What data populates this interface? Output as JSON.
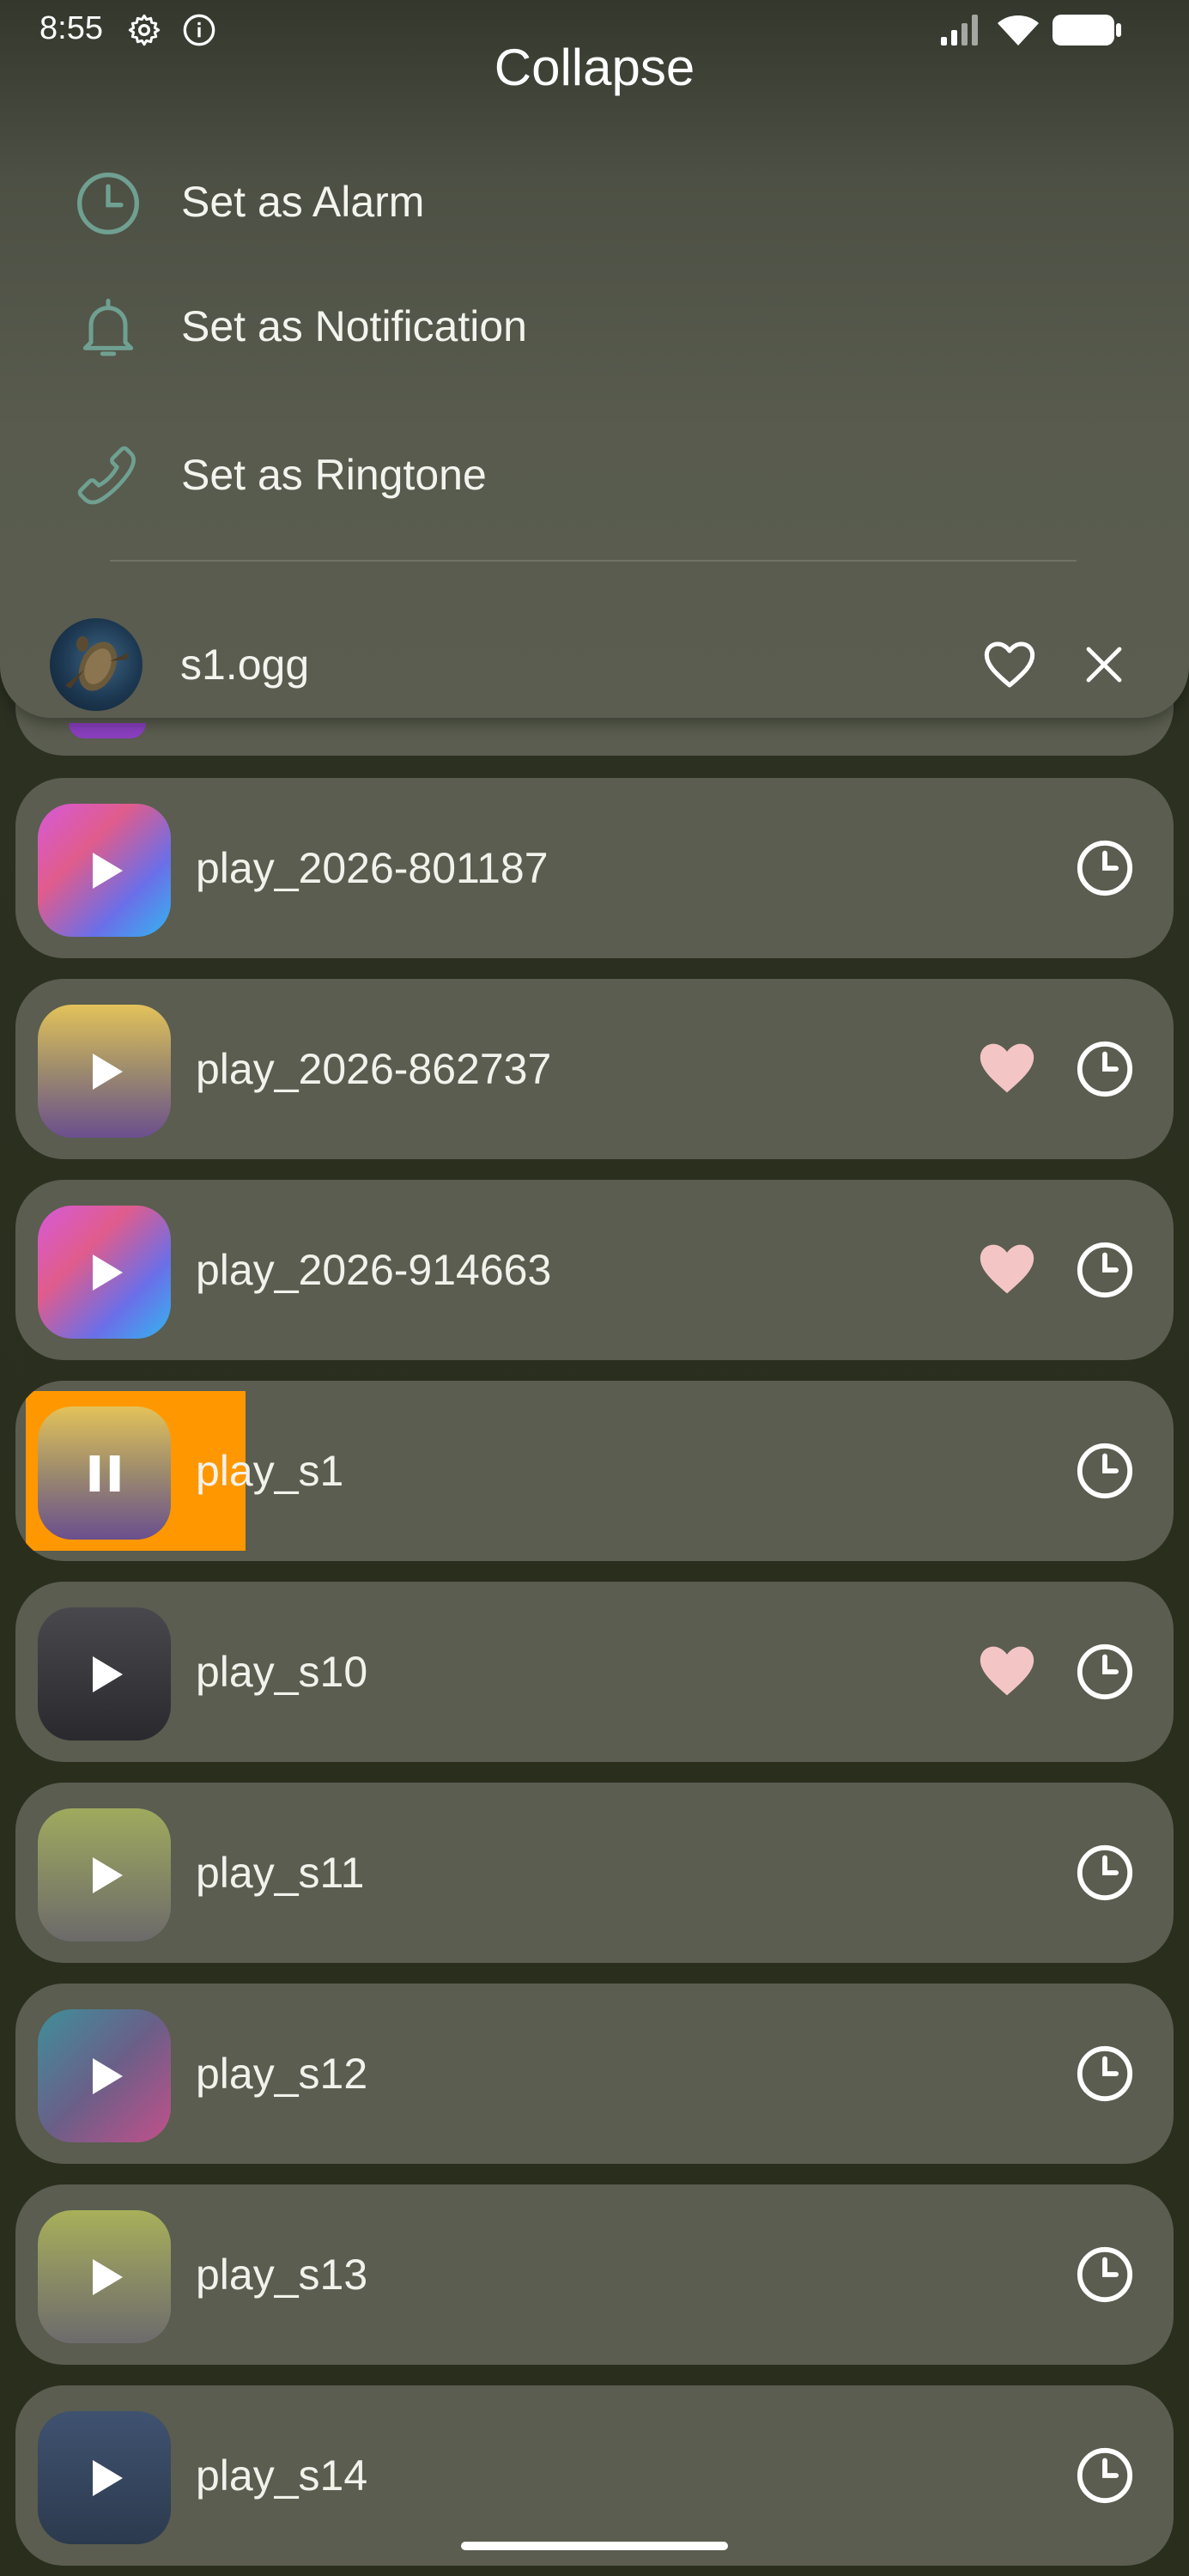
{
  "status_bar": {
    "time": "8:55"
  },
  "sheet": {
    "collapse_label": "Collapse",
    "menu": [
      {
        "label": "Set as Alarm",
        "icon": "clock-icon"
      },
      {
        "label": "Set as Notification",
        "icon": "bell-icon"
      },
      {
        "label": "Set as Ringtone",
        "icon": "phone-icon"
      }
    ],
    "now_playing": {
      "file": "s1.ogg"
    }
  },
  "colors": {
    "accent": "#ff9800",
    "favorite": "#f4c5c5",
    "menu_icon": "#6fa091"
  },
  "tracks": [
    {
      "title": "play_2026-801187",
      "favorite": false,
      "playing": false,
      "progress": 0
    },
    {
      "title": "play_2026-862737",
      "favorite": true,
      "playing": false,
      "progress": 0
    },
    {
      "title": "play_2026-914663",
      "favorite": true,
      "playing": false,
      "progress": 0
    },
    {
      "title": "play_s1",
      "favorite": false,
      "playing": true,
      "progress": 0.19
    },
    {
      "title": "play_s10",
      "favorite": true,
      "playing": false,
      "progress": 0
    },
    {
      "title": "play_s11",
      "favorite": false,
      "playing": false,
      "progress": 0
    },
    {
      "title": "play_s12",
      "favorite": false,
      "playing": false,
      "progress": 0
    },
    {
      "title": "play_s13",
      "favorite": false,
      "playing": false,
      "progress": 0
    },
    {
      "title": "play_s14",
      "favorite": false,
      "playing": false,
      "progress": 0
    }
  ]
}
